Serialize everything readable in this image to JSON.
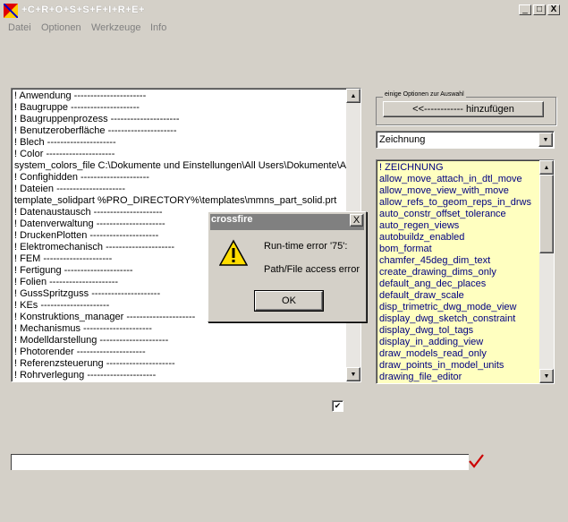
{
  "window": {
    "title": "+C+R+O+S+S+F+I+R+E+",
    "minimize": "_",
    "maximize": "□",
    "close": "X"
  },
  "menu": [
    "Datei",
    "Optionen",
    "Werkzeuge",
    "Info"
  ],
  "left_list": {
    "items": [
      "! Anwendung ----------------------",
      "! Baugruppe ---------------------",
      "! Baugruppenprozess ---------------------",
      "! Benutzeroberfläche ---------------------",
      "! Blech ---------------------",
      "! Color ---------------------",
      "system_colors_file C:\\Dokumente und Einstellungen\\All Users\\Dokumente\\Arb",
      "! Confighidden ---------------------",
      "! Dateien ---------------------",
      "template_solidpart %PRO_DIRECTORY%\\templates\\mmns_part_solid.prt",
      "! Datenaustausch ---------------------",
      "! Datenverwaltung ---------------------",
      "! DruckenPlotten ---------------------",
      "! Elektromechanisch ---------------------",
      "! FEM ---------------------",
      "! Fertigung ---------------------",
      "! Folien ---------------------",
      "! GussSpritzguss ---------------------",
      "! KEs ---------------------",
      "! Konstruktions_manager ---------------------",
      "! Mechanismus ---------------------",
      "! Modelldarstellung ---------------------",
      "! Photorender ---------------------",
      "! Referenzsteuerung ---------------------",
      "! Rohrverlegung ---------------------"
    ]
  },
  "options_group": {
    "label": "einige Optionen zur Auswahl",
    "add_button": "<<------------  hinzufügen"
  },
  "combo": {
    "selected": "Zeichnung"
  },
  "right_list": {
    "items": [
      "! ZEICHNUNG",
      "allow_move_attach_in_dtl_move",
      "allow_move_view_with_move",
      "allow_refs_to_geom_reps_in_drws",
      "auto_constr_offset_tolerance",
      "auto_regen_views",
      "autobuildz_enabled",
      "bom_format",
      "chamfer_45deg_dim_text",
      "create_drawing_dims_only",
      "default_ang_dec_places",
      "default_draw_scale",
      "disp_trimetric_dwg_mode_view",
      "display_dwg_sketch_constraint",
      "display_dwg_tol_tags",
      "display_in_adding_view",
      "draw_models_read_only",
      "draw_points_in_model_units",
      "drawing_file_editor"
    ]
  },
  "dialog": {
    "title": "crossfire",
    "close": "X",
    "message_line1": "Run-time error '75':",
    "message_line2": "Path/File access error",
    "ok": "OK"
  },
  "checkbox": {
    "checked": true,
    "mark": "✔"
  },
  "bottom_input": {
    "value": ""
  },
  "colors": {
    "accent_check": "#cc0000",
    "list_bg": "#ffffc0",
    "list_text": "#000080"
  }
}
